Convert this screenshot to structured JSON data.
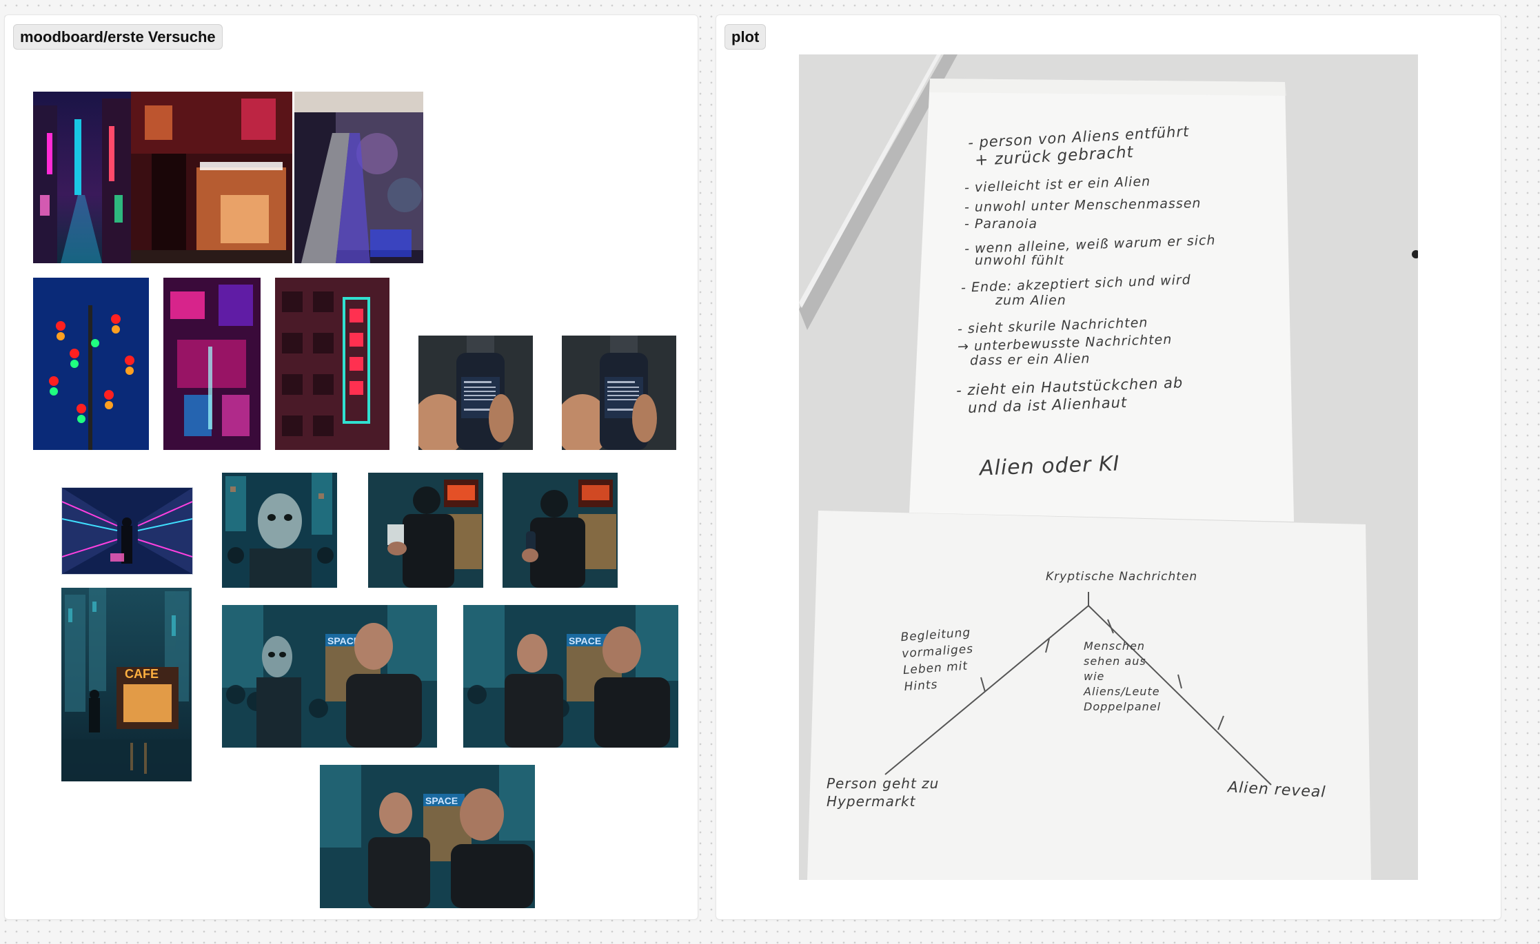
{
  "canvas": {
    "frames": [
      {
        "label": "moodboard/erste Versuche",
        "images": [
          {
            "name": "neon-alley-image"
          },
          {
            "name": "red-building-storefront-image"
          },
          {
            "name": "graffiti-escalator-image"
          },
          {
            "name": "traffic-lights-tree-image"
          },
          {
            "name": "neon-facade-pink-image"
          },
          {
            "name": "chinese-neon-sign-building-image"
          },
          {
            "name": "bottle-in-hand-image-1"
          },
          {
            "name": "bottle-in-hand-image-2"
          },
          {
            "name": "supermarket-aisle-man-image"
          },
          {
            "name": "alien-face-crowd-image"
          },
          {
            "name": "man-holding-card-cafe-image"
          },
          {
            "name": "man-holding-bottle-cafe-image"
          },
          {
            "name": "cafe-street-night-image"
          },
          {
            "name": "alien-and-man-space-image"
          },
          {
            "name": "two-men-space-image"
          },
          {
            "name": "two-men-space-closeup-image"
          }
        ],
        "cafe_sign": "CAFE",
        "space_sign": "SPACE"
      },
      {
        "label": "plot",
        "note_top_lines": [
          "- person von Aliens entführt",
          "  + zurück gebracht",
          "- vielleicht ist er ein Alien",
          "- unwohl unter Menschenmassen",
          "- Paranoia",
          "- wenn alleine, weiß warum er sich",
          "  unwohl fühlt",
          "- Ende: akzeptiert sich und wird",
          "  zum Alien",
          "- sieht skurile Nachrichten",
          "→ unterbewusste Nachrichten",
          "  dass er ein Alien",
          "- zieht ein Hautstückchen ab",
          "  und da ist Alienhaut"
        ],
        "note_top_footer": "Alien oder KI",
        "diagram": {
          "peak": "Kryptische Nachrichten",
          "left_mid": "Begleitung vormaliges Leben mit Hints",
          "right_mid": "Menschen sehen aus wie Aliens/Leute Doppelpanel",
          "left_end": "Person geht zu Hypermarkt",
          "right_end": "Alien reveal"
        }
      }
    ]
  }
}
